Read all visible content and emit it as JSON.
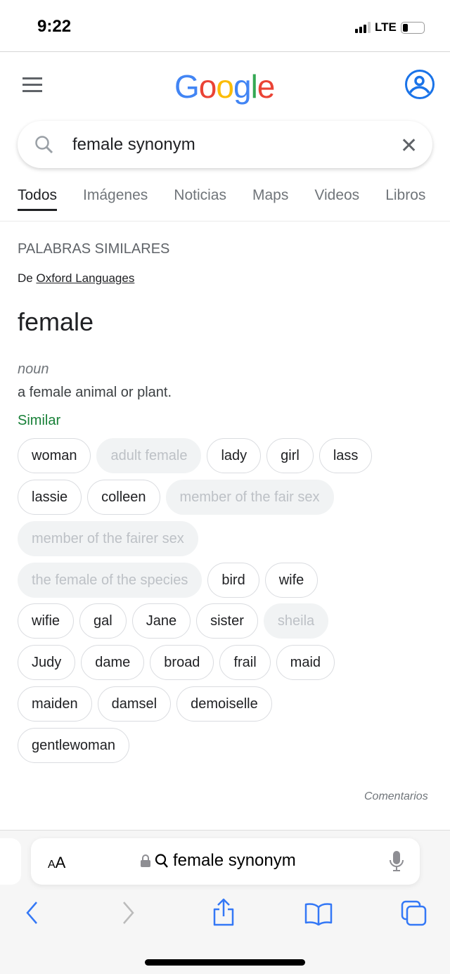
{
  "status": {
    "time": "9:22",
    "network": "LTE"
  },
  "header": {
    "logo": "Google",
    "logo_colors": [
      "#4285f4",
      "#ea4335",
      "#fbbc05",
      "#4285f4",
      "#34a853",
      "#ea4335"
    ]
  },
  "search": {
    "query": "female synonym"
  },
  "tabs": [
    {
      "label": "Todos",
      "active": true
    },
    {
      "label": "Imágenes"
    },
    {
      "label": "Noticias"
    },
    {
      "label": "Maps"
    },
    {
      "label": "Videos"
    },
    {
      "label": "Libros"
    }
  ],
  "dictionary": {
    "kicker": "PALABRAS SIMILARES",
    "source_prefix": "De",
    "source_link": "Oxford Languages",
    "word": "female",
    "pos": "noun",
    "definition": "a female animal or plant.",
    "similar_label": "Similar"
  },
  "chip_rows": [
    [
      {
        "label": "woman"
      },
      {
        "label": "adult female",
        "disabled": true
      },
      {
        "label": "lady"
      },
      {
        "label": "girl"
      },
      {
        "label": "lass"
      }
    ],
    [
      {
        "label": "lassie"
      },
      {
        "label": "colleen"
      },
      {
        "label": "member of the fair sex",
        "disabled": true
      }
    ],
    [
      {
        "label": "member of the fairer sex",
        "disabled": true
      }
    ],
    [
      {
        "label": "the female of the species",
        "disabled": true
      },
      {
        "label": "bird"
      },
      {
        "label": "wife"
      }
    ],
    [
      {
        "label": "wifie"
      },
      {
        "label": "gal"
      },
      {
        "label": "Jane"
      },
      {
        "label": "sister"
      },
      {
        "label": "sheila",
        "disabled": true
      }
    ],
    [
      {
        "label": "Judy"
      },
      {
        "label": "dame"
      },
      {
        "label": "broad"
      },
      {
        "label": "frail"
      },
      {
        "label": "maid"
      }
    ],
    [
      {
        "label": "maiden"
      },
      {
        "label": "damsel"
      },
      {
        "label": "demoiselle"
      }
    ],
    [
      {
        "label": "gentlewoman"
      }
    ]
  ],
  "feedback": "Comentarios",
  "browser": {
    "aa_small": "A",
    "aa_big": "A",
    "url": "female synonym",
    "accent": "#3478f6"
  }
}
